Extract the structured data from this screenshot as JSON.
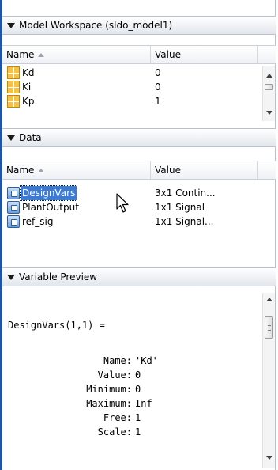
{
  "model_workspace": {
    "title": "Model Workspace (sldo_model1)",
    "columns": {
      "name": "Name",
      "value": "Value"
    },
    "rows": [
      {
        "name": "Kd",
        "value": "0"
      },
      {
        "name": "Ki",
        "value": "0"
      },
      {
        "name": "Kp",
        "value": "1"
      }
    ]
  },
  "data_section": {
    "title": "Data",
    "columns": {
      "name": "Name",
      "value": "Value"
    },
    "rows": [
      {
        "name": "DesignVars",
        "value": "3x1 Contin..."
      },
      {
        "name": "PlantOutput",
        "value": "1x1 Signal"
      },
      {
        "name": "ref_sig",
        "value": "1x1 Signal..."
      }
    ],
    "selected_row": "DesignVars"
  },
  "variable_preview": {
    "title": "Variable Preview",
    "header_line": "DesignVars(1,1) =",
    "fields": [
      {
        "label": "Name:",
        "value": "'Kd'"
      },
      {
        "label": "Value:",
        "value": "0"
      },
      {
        "label": "Minimum:",
        "value": "0"
      },
      {
        "label": "Maximum:",
        "value": "Inf"
      },
      {
        "label": "Free:",
        "value": "1"
      },
      {
        "label": "Scale:",
        "value": "1"
      }
    ]
  },
  "icons": {
    "model_workspace_rows": "matrix-variable-icon",
    "data_rows": "object-variable-icon",
    "section_toggle": "collapse-triangle-icon"
  },
  "colors": {
    "selection": "#3a7bd5",
    "accent_bar": "#1f56a3"
  }
}
